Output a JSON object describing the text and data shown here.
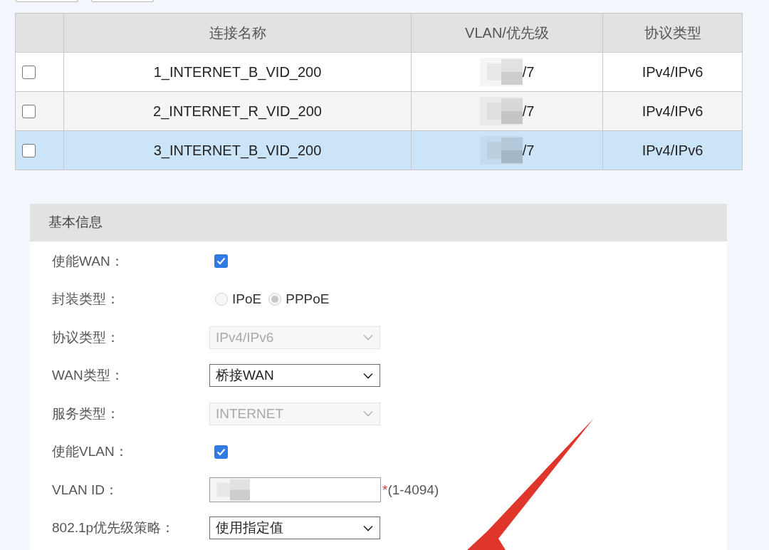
{
  "table": {
    "columns": [
      "连接名称",
      "VLAN/优先级",
      "协议类型"
    ],
    "rows": [
      {
        "checked": false,
        "selected": false,
        "name": "1_INTERNET_B_VID_200",
        "vlan_redacted": true,
        "vlan_priority": "/7",
        "protocol": "IPv4/IPv6"
      },
      {
        "checked": false,
        "selected": false,
        "name": "2_INTERNET_R_VID_200",
        "vlan_redacted": true,
        "vlan_priority": "/7",
        "protocol": "IPv4/IPv6"
      },
      {
        "checked": false,
        "selected": true,
        "name": "3_INTERNET_B_VID_200",
        "vlan_redacted": true,
        "vlan_priority": "/7",
        "protocol": "IPv4/IPv6"
      }
    ]
  },
  "basic_info": {
    "title": "基本信息",
    "fields": [
      {
        "kind": "checkbox",
        "label": "使能WAN：",
        "checked": true
      },
      {
        "kind": "radio",
        "label": "封装类型：",
        "options": [
          {
            "label": "IPoE",
            "selected": false,
            "disabled": true
          },
          {
            "label": "PPPoE",
            "selected": true,
            "disabled": true
          }
        ]
      },
      {
        "kind": "select",
        "label": "协议类型：",
        "value": "IPv4/IPv6",
        "disabled": true
      },
      {
        "kind": "select",
        "label": "WAN类型：",
        "value": "桥接WAN",
        "disabled": false
      },
      {
        "kind": "select",
        "label": "服务类型：",
        "value": "INTERNET",
        "disabled": true
      },
      {
        "kind": "checkbox",
        "label": "使能VLAN：",
        "checked": true
      },
      {
        "kind": "input",
        "label": "VLAN ID：",
        "redacted": true,
        "required_mark": "*",
        "hint": "(1-4094)"
      },
      {
        "kind": "select",
        "label": "802.1p优先级策略：",
        "value": "使用指定值",
        "disabled": false
      }
    ]
  }
}
